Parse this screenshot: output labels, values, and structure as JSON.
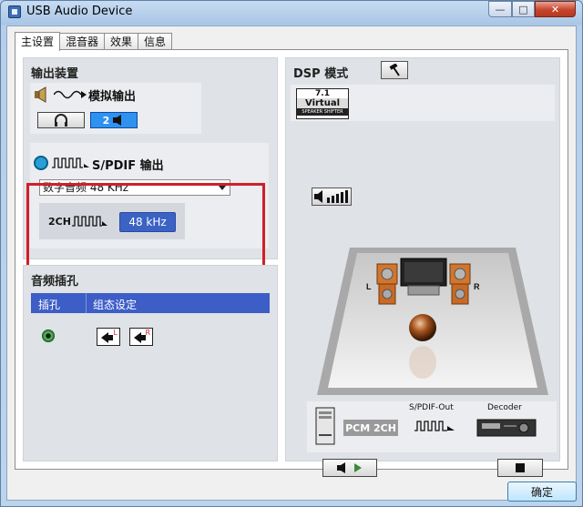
{
  "window": {
    "title": "USB Audio Device",
    "min_glyph": "—",
    "max_glyph": "□",
    "close_glyph": "✕"
  },
  "tabs": [
    {
      "label": "主设置",
      "active": true
    },
    {
      "label": "混音器",
      "active": false
    },
    {
      "label": "效果",
      "active": false
    },
    {
      "label": "信息",
      "active": false
    }
  ],
  "output": {
    "section_title": "输出装置",
    "analog_label": "模拟输出",
    "channel_label": "2",
    "spdif_label": "S/PDIF 输出",
    "format_select": "数字音频 48 KHz",
    "ch_label": "2CH",
    "rate_label": "48 kHz"
  },
  "jack": {
    "section_title": "音频插孔",
    "col_jack": "插孔",
    "col_config": "组态设定",
    "left_tag": "L",
    "right_tag": "R"
  },
  "dsp": {
    "title": "DSP 模式",
    "virtual_top": "7.1",
    "virtual_mid": "Virtual",
    "virtual_bottom": "SPEAKER SHIFTER",
    "speaker_left": "L",
    "speaker_right": "R",
    "pcm_label": "PCM 2CH",
    "spdif_out": "S/PDIF-Out",
    "decoder": "Decoder"
  },
  "footer": {
    "ok_label": "确定"
  },
  "colors": {
    "accent_blue": "#3b63c4",
    "highlight_frame": "#d11f2a",
    "channel_blue": "#2f92f0"
  }
}
